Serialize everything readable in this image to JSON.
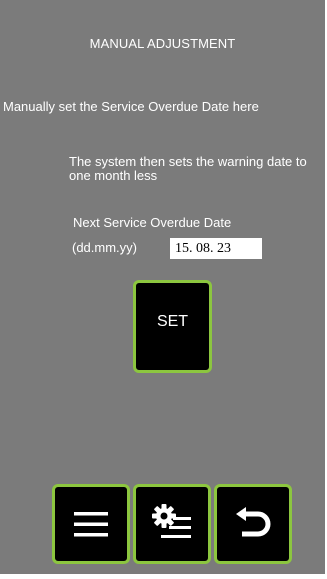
{
  "screen": {
    "title": "MANUAL ADJUSTMENT",
    "instruction": "Manually set the Service Overdue Date here",
    "note": "The system then sets the warning date to one month less"
  },
  "field": {
    "label": "Next Service Overdue Date",
    "format": "(dd.mm.yy)",
    "value": "15. 08. 23"
  },
  "buttons": {
    "set_label": "SET",
    "menu_icon": "menu-icon",
    "settings_icon": "settings-list-icon",
    "back_icon": "back-arrow-icon"
  },
  "colors": {
    "panel_bg": "#7b7b7b",
    "button_bg": "#000000",
    "button_border": "#8cc63f",
    "text": "#ffffff"
  }
}
